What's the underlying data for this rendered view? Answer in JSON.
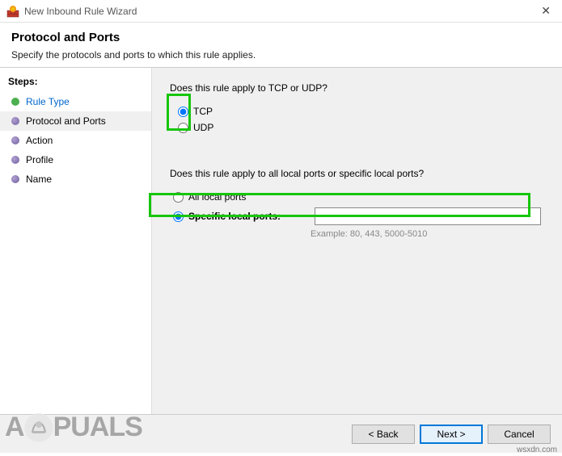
{
  "window": {
    "title": "New Inbound Rule Wizard"
  },
  "header": {
    "title": "Protocol and Ports",
    "subtitle": "Specify the protocols and ports to which this rule applies."
  },
  "sidebar": {
    "heading": "Steps:",
    "items": [
      {
        "label": "Rule Type",
        "state": "completed"
      },
      {
        "label": "Protocol and Ports",
        "state": "active"
      },
      {
        "label": "Action",
        "state": "pending"
      },
      {
        "label": "Profile",
        "state": "pending"
      },
      {
        "label": "Name",
        "state": "pending"
      }
    ]
  },
  "main": {
    "protocol_question": "Does this rule apply to TCP or UDP?",
    "tcp_label": "TCP",
    "udp_label": "UDP",
    "protocol_selected": "tcp",
    "ports_question": "Does this rule apply to all local ports or specific local ports?",
    "all_ports_label": "All local ports",
    "specific_ports_label": "Specific local ports:",
    "ports_selected": "specific",
    "ports_value": "",
    "ports_example": "Example: 80, 443, 5000-5010"
  },
  "footer": {
    "back": "< Back",
    "next": "Next >",
    "cancel": "Cancel"
  },
  "watermark": {
    "text_before": "A",
    "text_after": "PUALS",
    "attribution": "wsxdn.com"
  }
}
